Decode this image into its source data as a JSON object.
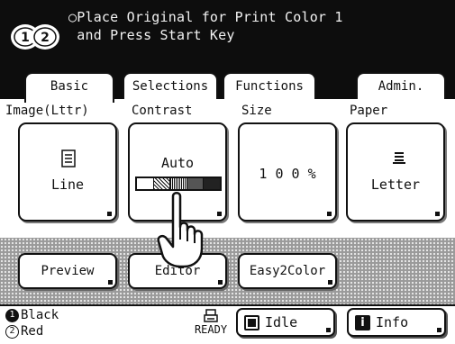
{
  "header": {
    "message": "○Place Original for Print Color 1\n and Press Start Key",
    "drum_icon": "print-drum-1-2-icon"
  },
  "tabs": [
    {
      "label": "Basic",
      "active": true
    },
    {
      "label": "Selections",
      "active": false
    },
    {
      "label": "Functions",
      "active": false
    },
    {
      "label": "Admin.",
      "active": false
    }
  ],
  "params": {
    "image": {
      "label": "Image(Lttr)",
      "value": "Line",
      "icon": "document-icon"
    },
    "contrast": {
      "label": "Contrast",
      "value": "Auto",
      "levels": 5
    },
    "size": {
      "label": "Size",
      "value": "1 0 0 %"
    },
    "paper": {
      "label": "Paper",
      "value": "Letter",
      "icon": "paper-icon"
    }
  },
  "strip_buttons": {
    "preview": "Preview",
    "editor": "Editor",
    "easy2color": "Easy2Color"
  },
  "status": {
    "color1": {
      "num": "1",
      "label": "Black"
    },
    "color2": {
      "num": "2",
      "label": "Red"
    },
    "ready": "READY",
    "idle": "Idle",
    "info": "Info"
  },
  "colors": {
    "header_bg": "#0d0d0d",
    "strip_bg": "#9a9a9a"
  }
}
